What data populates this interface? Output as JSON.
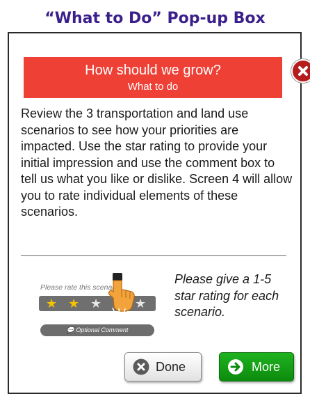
{
  "slide_title": "“What to Do” Pop-up Box",
  "popup": {
    "banner_title": "How should we grow?",
    "banner_subtitle": "What to do",
    "instructions": "Review the 3 transportation and land use scenarios to see how your priorities are impacted. Use the star rating to provide your initial impression and use the comment box to tell us what you like or dislike. Screen 4 will allow you to rate individual elements of these scenarios.",
    "example": {
      "prompt_text": "Please rate this scenario:",
      "rating": 2,
      "max_rating": 5,
      "comment_label": "Optional Comment"
    },
    "rating_hint": "Please give a 1-5 star rating for each scenario.",
    "buttons": {
      "done": "Done",
      "more": "More"
    }
  },
  "colors": {
    "title": "#3b1f8a",
    "banner": "#ef4036",
    "close": "#b71c1c",
    "more_button": "#149d14",
    "star_filled": "#f5c400",
    "star_empty": "#e6e6e6"
  },
  "icons": {
    "close": "close-icon",
    "done": "x-circle-icon",
    "more": "arrow-right-circle-icon",
    "pointer": "pointing-hand-icon",
    "comment": "speech-bubble-icon"
  }
}
